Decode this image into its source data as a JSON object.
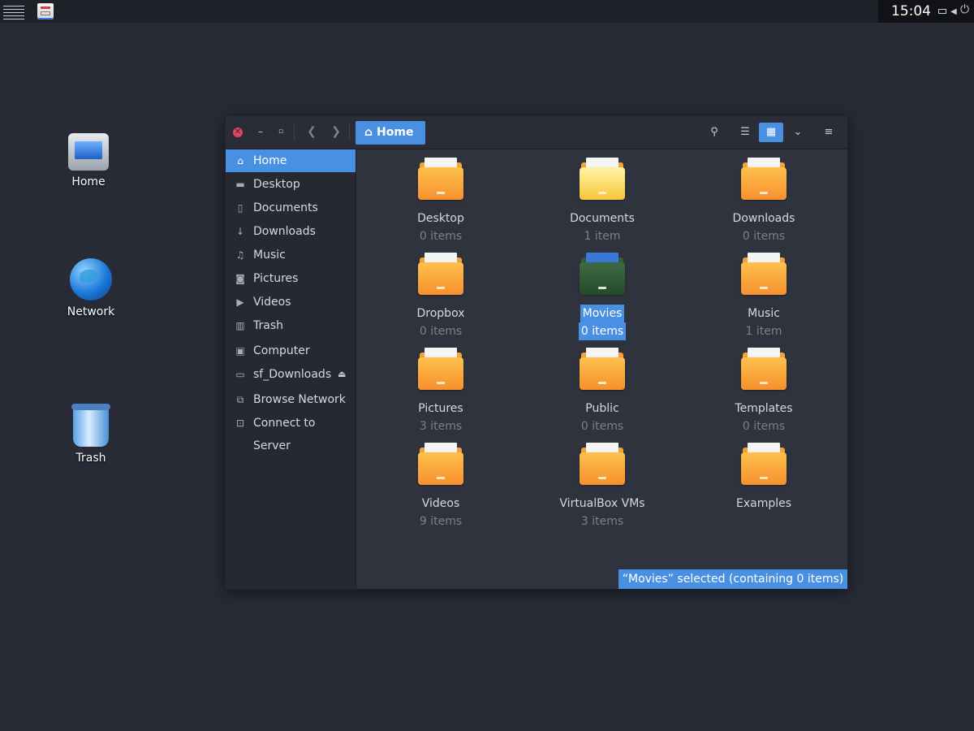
{
  "top_panel": {
    "clock": "15:04",
    "icons": [
      "menu-icon",
      "app-launcher-icon",
      "battery-icon",
      "speaker-icon",
      "power-icon"
    ]
  },
  "desktop_icons": [
    {
      "label": "Home",
      "icon": "computer-icon"
    },
    {
      "label": "Network",
      "icon": "globe-icon"
    },
    {
      "label": "Trash",
      "icon": "trash-icon"
    }
  ],
  "window": {
    "path_button": "Home",
    "toolbar_icons": [
      "search-icon",
      "list-view-icon",
      "grid-view-icon",
      "chevron-down-icon",
      "hamburger-menu-icon"
    ],
    "sidebar": [
      {
        "label": "Home",
        "icon": "home-icon",
        "active": true
      },
      {
        "label": "Desktop",
        "icon": "folder-icon"
      },
      {
        "label": "Documents",
        "icon": "document-icon"
      },
      {
        "label": "Downloads",
        "icon": "download-icon"
      },
      {
        "label": "Music",
        "icon": "music-icon"
      },
      {
        "label": "Pictures",
        "icon": "camera-icon"
      },
      {
        "label": "Videos",
        "icon": "video-icon"
      },
      {
        "label": "Trash",
        "icon": "trash-icon"
      },
      {
        "label": "Computer",
        "icon": "computer-icon"
      },
      {
        "label": "sf_Downloads",
        "icon": "drive-icon",
        "eject": true
      },
      {
        "label": "Browse Network",
        "icon": "network-icon"
      },
      {
        "label": "Connect to Server",
        "icon": "server-icon"
      }
    ],
    "items": [
      {
        "name": "Desktop",
        "count": "0 items"
      },
      {
        "name": "Documents",
        "count": "1 item"
      },
      {
        "name": "Downloads",
        "count": "0 items"
      },
      {
        "name": "Dropbox",
        "count": "0 items"
      },
      {
        "name": "Movies",
        "count": "0 items",
        "selected": true
      },
      {
        "name": "Music",
        "count": "1 item"
      },
      {
        "name": "Pictures",
        "count": "3 items"
      },
      {
        "name": "Public",
        "count": "0 items"
      },
      {
        "name": "Templates",
        "count": "0 items"
      },
      {
        "name": "Videos",
        "count": "9 items"
      },
      {
        "name": "VirtualBox VMs",
        "count": "3 items"
      },
      {
        "name": "Examples",
        "count": ""
      }
    ],
    "status": "“Movies” selected (containing 0 items)"
  },
  "colors": {
    "accent": "#4a90e2",
    "background": "#282b36",
    "folder": "#f7a234",
    "close": "#e0465b"
  }
}
